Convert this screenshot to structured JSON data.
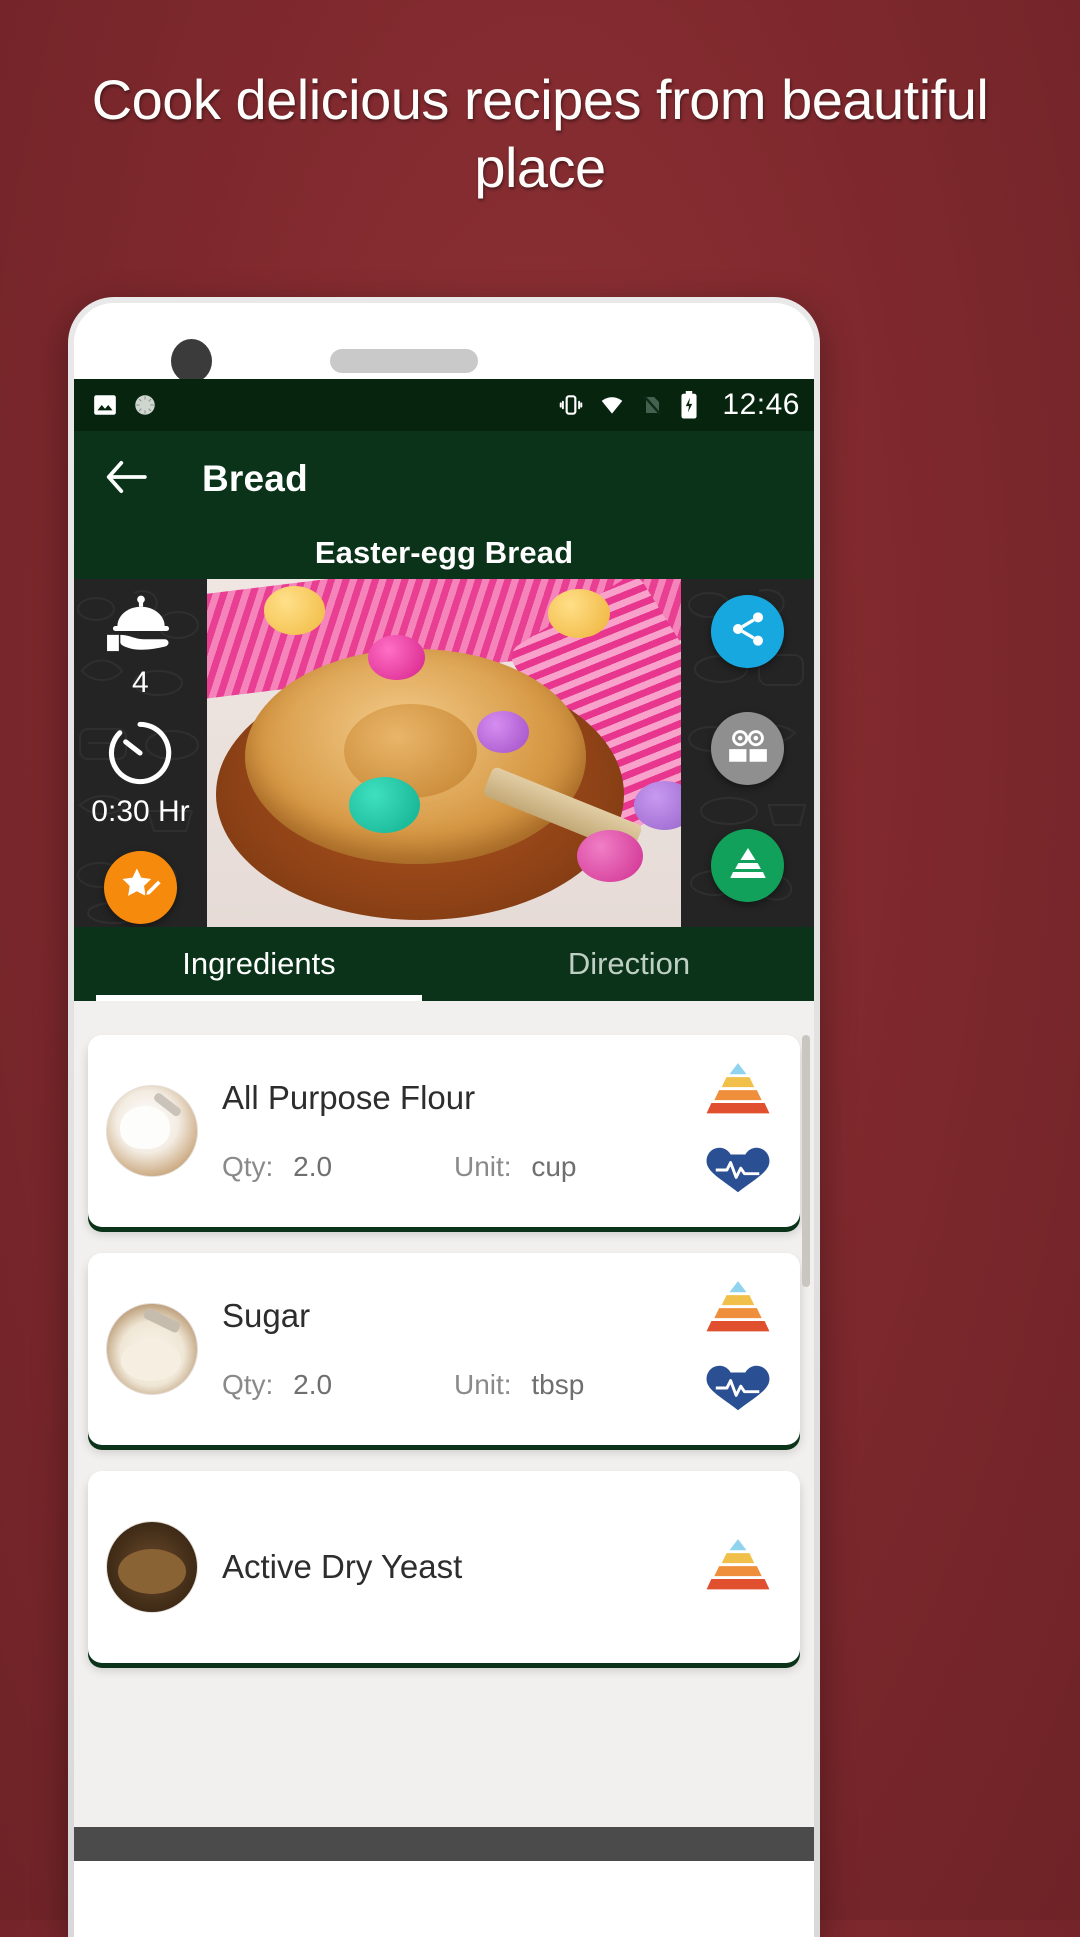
{
  "promo": {
    "headline": "Cook delicious recipes from beautiful place"
  },
  "statusbar": {
    "clock": "12:46",
    "icons": [
      "image-icon",
      "loader-icon",
      "vibrate-icon",
      "wifi-icon",
      "no-sim-icon",
      "battery-charging-icon"
    ]
  },
  "appbar": {
    "back_icon": "back-arrow-icon",
    "title": "Bread"
  },
  "recipe": {
    "name": "Easter-egg Bread",
    "servings": "4",
    "servings_icon": "serving-tray-icon",
    "time": "0:30 Hr",
    "time_icon": "timer-icon",
    "rate_icon": "star-edit-icon",
    "actions": [
      {
        "name": "share",
        "icon": "share-icon",
        "color": "#18a8e0"
      },
      {
        "name": "read",
        "icon": "book-owl-icon",
        "color": "#8f8f8f"
      },
      {
        "name": "nutrition-pyramid",
        "icon": "food-pyramid-icon",
        "color": "#12a15a"
      }
    ]
  },
  "tabs": [
    {
      "label": "Ingredients",
      "active": true
    },
    {
      "label": "Direction",
      "active": false
    }
  ],
  "labels": {
    "qty": "Qty:",
    "unit": "Unit:"
  },
  "ingredients": [
    {
      "name": "All Purpose Flour",
      "qty": "2.0",
      "unit": "cup",
      "thumb": "flour-thumb",
      "icons": [
        "food-pyramid-icon",
        "health-muscle-icon"
      ]
    },
    {
      "name": "Sugar",
      "qty": "2.0",
      "unit": "tbsp",
      "thumb": "sugar-thumb",
      "icons": [
        "food-pyramid-icon",
        "health-muscle-icon"
      ]
    },
    {
      "name": "Active Dry Yeast",
      "qty": "",
      "unit": "",
      "thumb": "yeast-thumb",
      "icons": [
        "food-pyramid-icon",
        "health-muscle-icon"
      ]
    }
  ],
  "colors": {
    "background": "#80292e",
    "app_green": "#0a3319",
    "status_green": "#07240f",
    "accent_orange": "#f68a0c",
    "share_blue": "#18a8e0",
    "read_grey": "#8f8f8f",
    "pyramid_green": "#12a15a"
  }
}
